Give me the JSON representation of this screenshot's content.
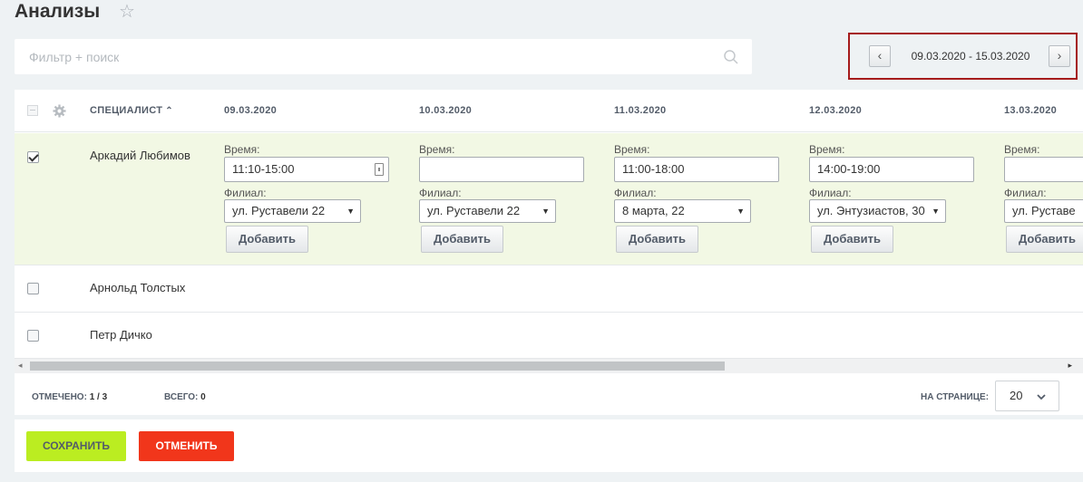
{
  "page": {
    "title": "Анализы"
  },
  "search": {
    "placeholder": "Фильтр + поиск"
  },
  "date_nav": {
    "range": "09.03.2020 - 15.03.2020",
    "prev": "‹",
    "next": "›"
  },
  "grid": {
    "columns": {
      "specialist": "СПЕЦИАЛИСТ",
      "days": [
        "09.03.2020",
        "10.03.2020",
        "11.03.2020",
        "12.03.2020",
        "13.03.2020"
      ]
    },
    "rows": [
      {
        "name": "Аркадий Любимов",
        "checked": true,
        "cells": [
          {
            "time_label": "Время:",
            "time": "11:10-15:00",
            "branch_label": "Филиал:",
            "branch": "ул. Руставели 22",
            "add": "Добавить"
          },
          {
            "time_label": "Время:",
            "time": "",
            "branch_label": "Филиал:",
            "branch": "ул. Руставели 22",
            "add": "Добавить"
          },
          {
            "time_label": "Время:",
            "time": "11:00-18:00",
            "branch_label": "Филиал:",
            "branch": "8 марта, 22",
            "add": "Добавить"
          },
          {
            "time_label": "Время:",
            "time": "14:00-19:00",
            "branch_label": "Филиал:",
            "branch": "ул. Энтузиастов, 30",
            "add": "Добавить"
          },
          {
            "time_label": "Время:",
            "time": "",
            "branch_label": "Филиал:",
            "branch": "ул. Руставе",
            "add": "Добавить"
          }
        ]
      },
      {
        "name": "Арнольд Толстых",
        "checked": false
      },
      {
        "name": "Петр Дичко",
        "checked": false
      }
    ]
  },
  "footer": {
    "selected_label": "ОТМЕЧЕНО:",
    "selected_value": "1 / 3",
    "total_label": "ВСЕГО:",
    "total_value": "0",
    "per_page_label": "НА СТРАНИЦЕ:",
    "per_page_value": "20"
  },
  "actions": {
    "save": "СОХРАНИТЬ",
    "cancel": "ОТМЕНИТЬ"
  },
  "colors": {
    "accent_green": "#bbed21",
    "danger_red": "#f1361b",
    "highlight_border": "#a51b1b",
    "selected_row": "#f2f8e4"
  },
  "icons": {
    "favorite": "star-icon",
    "search": "search-icon",
    "settings": "gear-icon",
    "sort": "sort-asc-icon",
    "calendar": "calendar-icon",
    "per_page": "chevron-down-icon"
  }
}
